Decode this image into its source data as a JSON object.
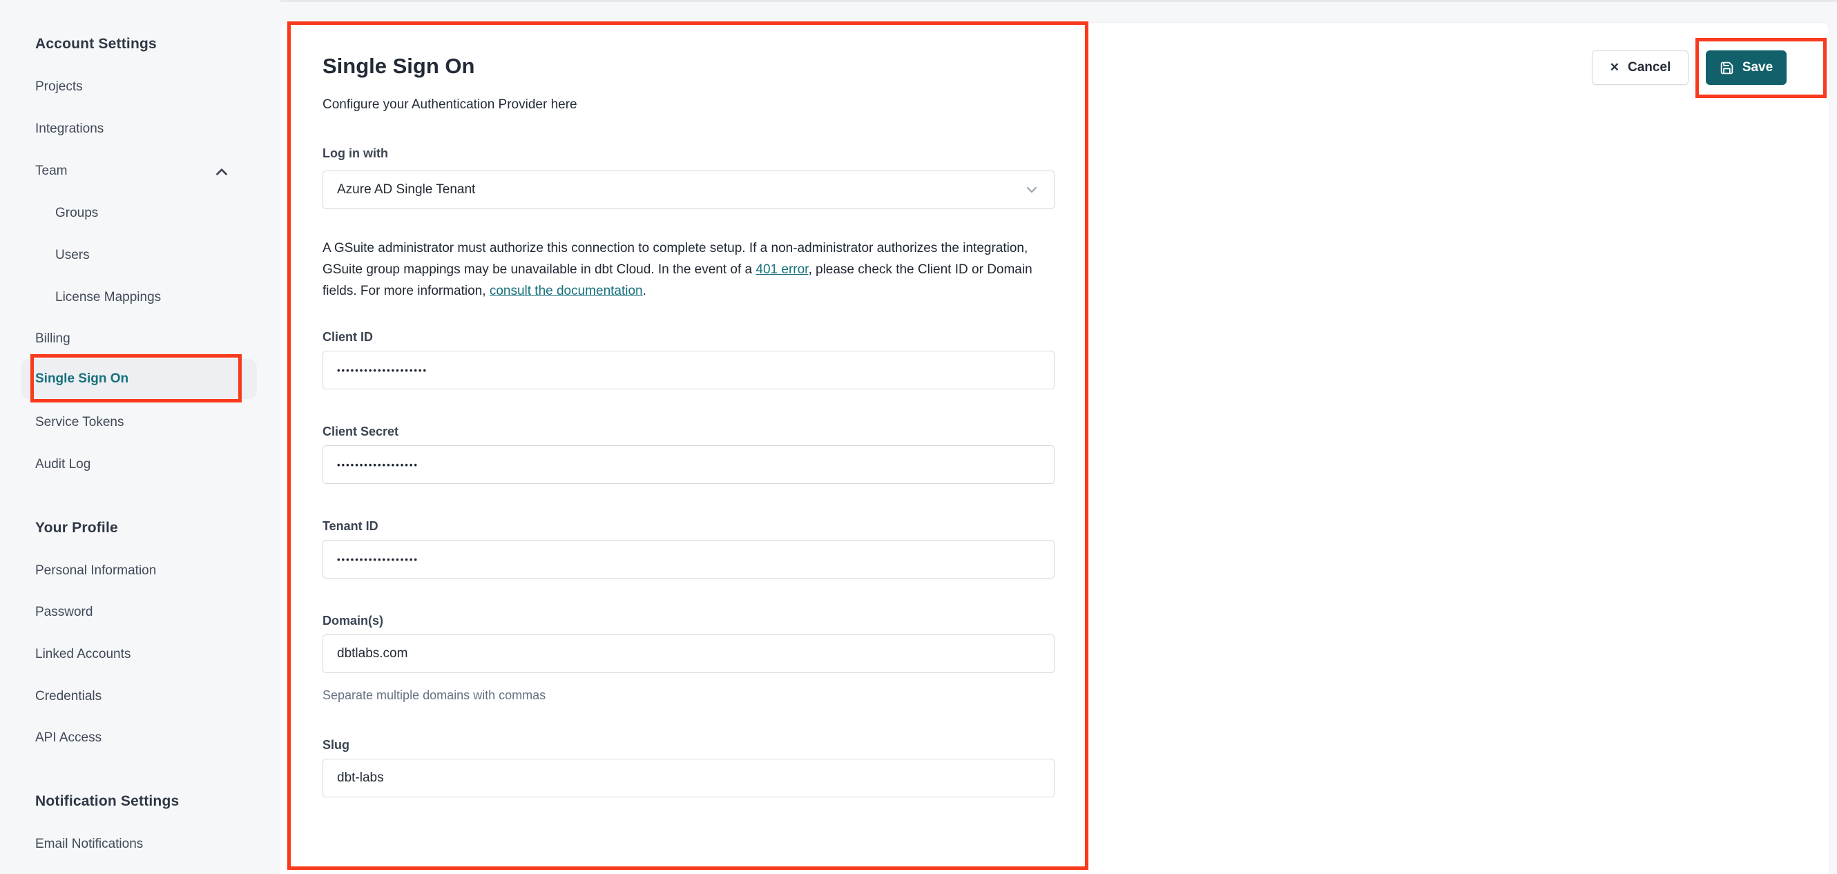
{
  "colors": {
    "accent_teal": "#16717c",
    "save_button_bg": "#11606a",
    "annotation_red": "#fa3a1c",
    "page_bg": "#f6f7f9",
    "card_bg": "#ffffff",
    "active_pill_bg": "#edeff2",
    "text_dark": "#232b36",
    "text_sidebar": "#3f4957",
    "helper_gray": "#667083"
  },
  "sidebar": {
    "sections": [
      {
        "header": "Account Settings",
        "items": [
          {
            "label": "Projects"
          },
          {
            "label": "Integrations"
          },
          {
            "label": "Team",
            "expanded": true
          },
          {
            "label": "Groups",
            "sub": true
          },
          {
            "label": "Users",
            "sub": true
          },
          {
            "label": "License Mappings",
            "sub": true
          },
          {
            "label": "Billing"
          },
          {
            "label": "Single Sign On",
            "active": true
          },
          {
            "label": "Service Tokens"
          },
          {
            "label": "Audit Log"
          }
        ]
      },
      {
        "header": "Your Profile",
        "items": [
          {
            "label": "Personal Information"
          },
          {
            "label": "Password"
          },
          {
            "label": "Linked Accounts"
          },
          {
            "label": "Credentials"
          },
          {
            "label": "API Access"
          }
        ]
      },
      {
        "header": "Notification Settings",
        "items": [
          {
            "label": "Email Notifications"
          }
        ]
      }
    ]
  },
  "main": {
    "title": "Single Sign On",
    "subtitle": "Configure your Authentication Provider here",
    "actions": {
      "cancel_label": "Cancel",
      "save_label": "Save",
      "cancel_icon": "close-icon",
      "save_icon": "floppy-disk-icon"
    },
    "form": {
      "login_with": {
        "label": "Log in with",
        "value": "Azure AD Single Tenant"
      },
      "description": {
        "part1": "A GSuite administrator must authorize this connection to complete setup. If a non-administrator authorizes the integration, GSuite group mappings may be unavailable in dbt Cloud. In the event of a ",
        "link1": "401 error",
        "part2": ", please check the Client ID or Domain fields. For more information, ",
        "link2": "consult the documentation",
        "part3": "."
      },
      "client_id": {
        "label": "Client ID",
        "value": "••••••••••••••••••••"
      },
      "client_secret": {
        "label": "Client Secret",
        "value": "••••••••••••••••••"
      },
      "tenant_id": {
        "label": "Tenant ID",
        "value": "••••••••••••••••••"
      },
      "domains": {
        "label": "Domain(s)",
        "value": "dbtlabs.com",
        "helper": "Separate multiple domains with commas"
      },
      "slug": {
        "label": "Slug",
        "value": "dbt-labs"
      }
    }
  }
}
